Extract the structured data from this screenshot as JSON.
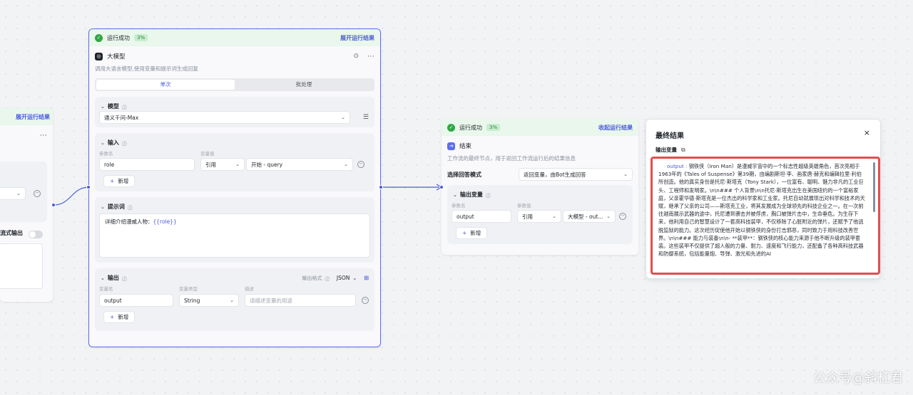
{
  "run_status": {
    "label": "运行成功",
    "percent": "3%",
    "expand": "展开运行结果",
    "collapse": "收起运行结果"
  },
  "left_node": {
    "expand": "展开运行结果",
    "stream_label": "流式输出"
  },
  "llm": {
    "title": "大模型",
    "desc": "调用大语言模型,使用变量和提示词生成回复",
    "tabs": [
      "单次",
      "批处理"
    ],
    "model_section": "模型",
    "model_value": "通义千问-Max",
    "input_section": "输入",
    "param_header": "参数名",
    "value_header": "变量值",
    "input_name": "role",
    "input_type": "引用",
    "input_ref": "开始 - query",
    "add_label": "新增",
    "prompt_section": "提示词",
    "prompt_text": "详细介绍漫威人物：",
    "prompt_var": "{{role}}",
    "output_section": "输出",
    "output_format_label": "输出格式",
    "output_format": "JSON",
    "var_name_header": "变量名",
    "var_type_header": "变量类型",
    "var_desc_header": "描述",
    "output_name": "output",
    "output_type": "String",
    "output_desc_placeholder": "请描述变量的用途"
  },
  "end_node": {
    "title": "结束",
    "desc": "工作流的最终节点，用于返回工作流运行后的结果信息",
    "mode_label": "选择回答模式",
    "mode_value": "返回变量，由Bot生成回答",
    "output_section": "输出变量",
    "param_header": "参数名",
    "value_header": "参数值",
    "output_name": "output",
    "output_type": "引用",
    "output_ref": "大模型 - out...",
    "add_label": "新增"
  },
  "result": {
    "title": "最终结果",
    "var_label": "输出变量",
    "key": "output",
    "text": "钢铁侠（Iron Man）是漫威宇宙中的一个标志性超级英雄角色，首次亮相于1963年的《Tales of Suspense》第39期，由编剧斯坦·李、画家唐·赫克和编辑拉里·利伯所创造。他的真实身份是托尼·斯塔克（Tony Stark），一位富有、聪明、魅力非凡的工业巨头、工程师和发明家。\\n\\n### 个人背景\\n\\n托尼·斯塔克出生在美国纽约的一个富裕家庭，父亲霍华德·斯塔克是一位杰出的科学家和工业家。托尼自幼就展现出对科学和技术的天赋，继承了父亲的公司——斯塔克工业，将其发展成为全球领先的科技企业之一。在一次前往越南展示武器的途中，托尼遭到袭击并被俘虏，胸口被弹片击中，生命垂危。为生存下来，他利用自己的智慧设计了一套高科技装甲，不仅移除了心脏附近的弹片，还赋予了他逃脱监狱的能力。这次经历促使他开始以钢铁侠的身份打击邪恶，同时致力于用科技改善世界。\\n\\n### 能力与装备\\n\\n- **装甲**：钢铁侠的核心能力来源于他不断升级的装甲套装。这些装甲不仅提供了超人般的力量、耐力、速度和飞行能力，还配备了各种高科技武器和防御系统，包括能量炮、导弹、激光和先进的AI"
  },
  "watermark": "公众号@斜杠君"
}
